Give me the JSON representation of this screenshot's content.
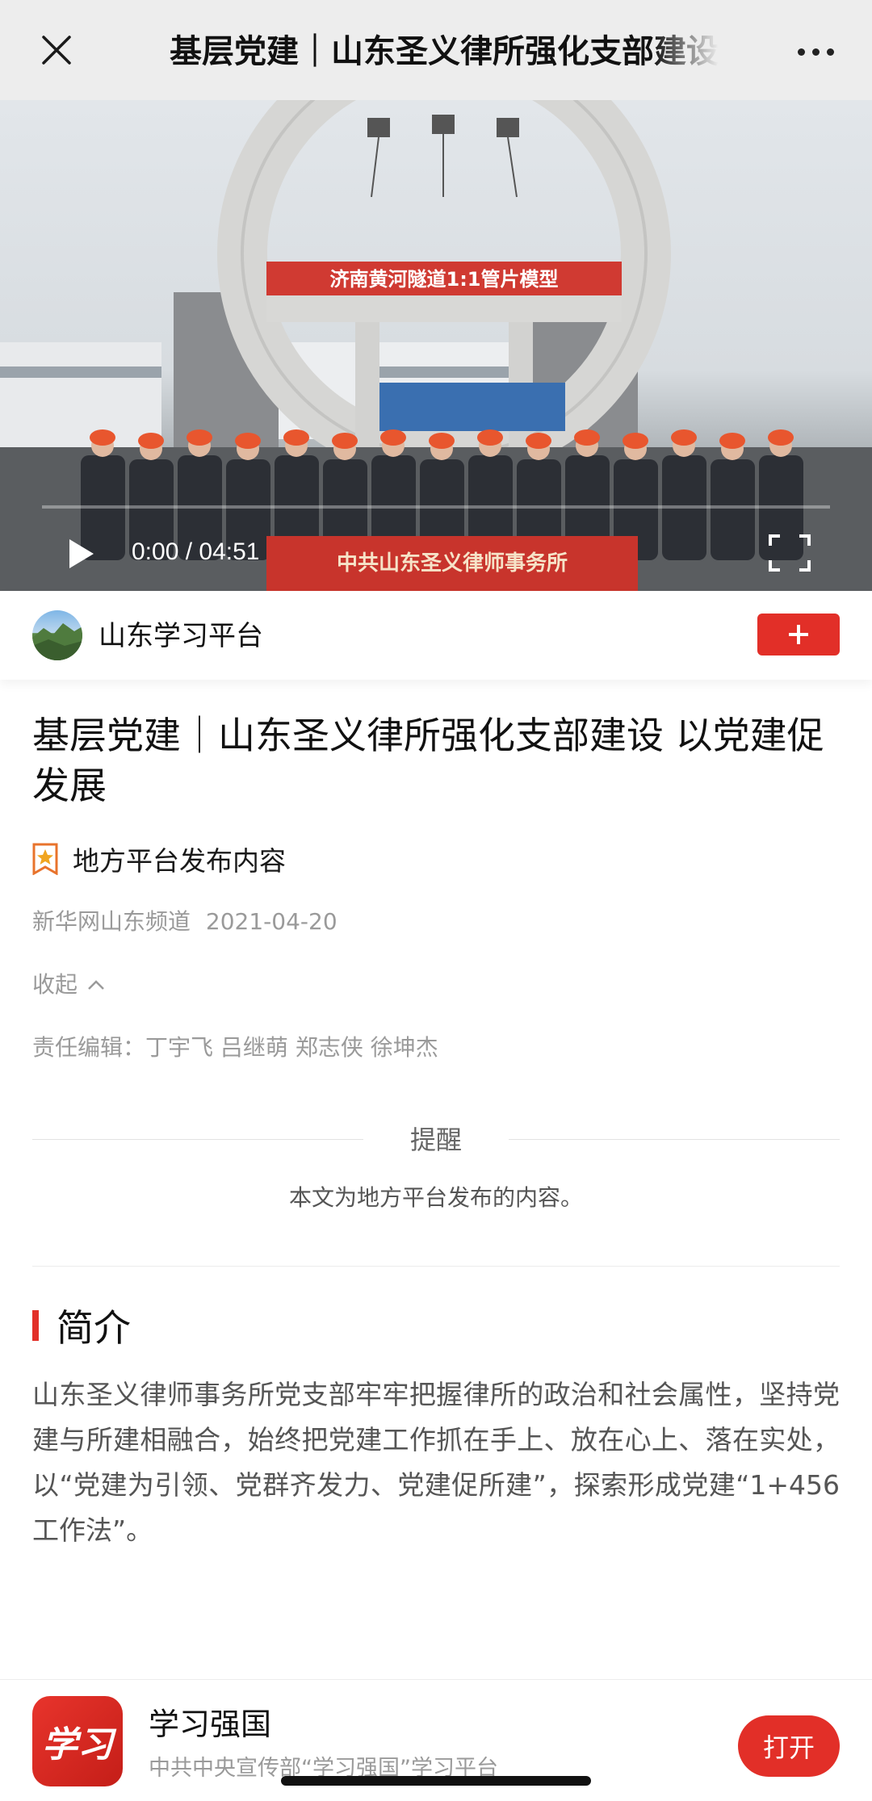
{
  "nav": {
    "title": "基层党建｜山东圣义律所强化支部建设 以党建促发展",
    "close_icon": "close-icon",
    "more_icon": "more-dots-icon"
  },
  "video": {
    "banner_text": "济南黄河隧道1:1管片模型",
    "group_banner_text": "中共山东圣义律师事务所",
    "current_time": "0:00",
    "separator": "/",
    "duration": "04:51",
    "progress": 0.0,
    "play_icon": "play-icon",
    "fullscreen_icon": "fullscreen-icon"
  },
  "channel": {
    "name": "山东学习平台",
    "follow_icon": "plus-icon",
    "follow_color": "#e22f28"
  },
  "article": {
    "title": "基层党建｜山东圣义律所强化支部建设 以党建促发展",
    "source_tag": "地方平台发布内容",
    "source": "新华网山东频道",
    "date": "2021-04-20",
    "collapse_label": "收起",
    "editors_label": "责任编辑：",
    "editors": "丁宇飞 吕继萌 郑志侠 徐坤杰"
  },
  "reminder": {
    "title": "提醒",
    "text": "本文为地方平台发布的内容。"
  },
  "intro": {
    "heading": "简介",
    "body": "山东圣义律师事务所党支部牢牢把握律所的政治和社会属性，坚持党建与所建相融合，始终把党建工作抓在手上、放在心上、落在实处，以“党建为引领、党群齐发力、党建促所建”，探索形成党建“1+456工作法”。"
  },
  "app_bar": {
    "icon_text": "学习",
    "name": "学习强国",
    "subtitle": "中共中央宣传部“学习强国”学习平台",
    "open_label": "打开",
    "accent": "#e22f28"
  }
}
